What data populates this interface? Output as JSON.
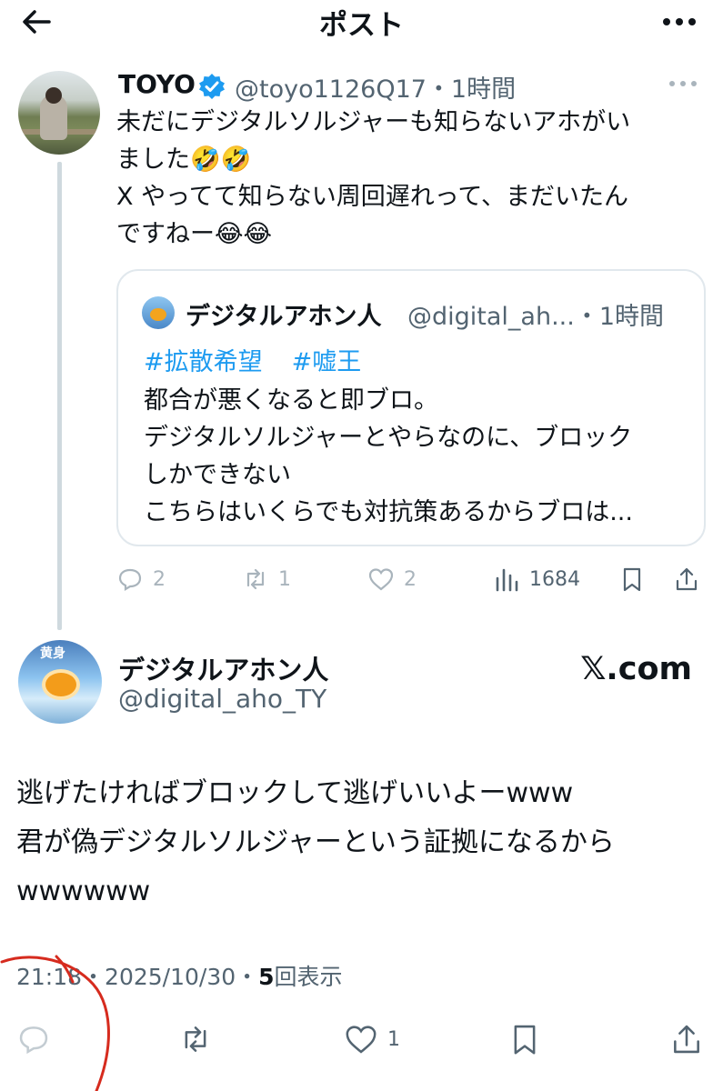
{
  "header": {
    "title": "ポスト",
    "back_icon": "back-arrow-icon",
    "more_icon": "more-icon"
  },
  "post": {
    "author_name": "TOYO",
    "verified": true,
    "handle_time": "@toyo1126Q17・1時間",
    "text_lines": [
      "未だにデジタルソルジャーも知らないアホがい",
      "ました🤣🤣",
      "X やってて知らない周回遅れって、まだいたん",
      "ですねー😂😂"
    ],
    "quote": {
      "author_name": "デジタルアホン人",
      "handle_time": "@digital_ah...・1時間",
      "hashtags": [
        "#拡散希望",
        "#嘘王"
      ],
      "text_lines": [
        "都合が悪くなると即ブロ。",
        "デジタルソルジャーとやらなのに、ブロック",
        "しかできない",
        "こちらはいくらでも対抗策あるからブロは..."
      ]
    },
    "actions": {
      "replies": "2",
      "reposts": "1",
      "likes": "2",
      "views": "1684"
    }
  },
  "reply": {
    "author_name": "デジタルアホン人",
    "handle": "@digital_aho_TY",
    "source": "𝕏.com",
    "text_lines": [
      "逃げたければブロックして逃げいいよーwww",
      "君が偽デジタルソルジャーという証拠になるから",
      "wwwwww"
    ],
    "timestamp": "21:18・2025/10/30・",
    "view_count": "5",
    "view_label": "回表示",
    "actions": {
      "likes": "1"
    }
  },
  "colors": {
    "link": "#1d9bf0",
    "muted": "#536471",
    "annotation": "#d62b1e"
  }
}
